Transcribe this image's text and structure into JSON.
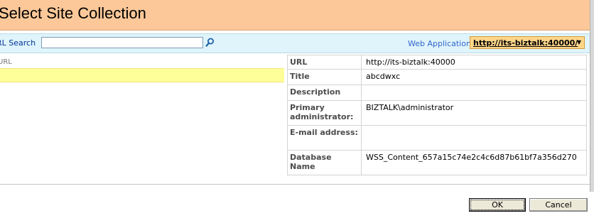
{
  "dialog": {
    "title": "Select Site Collection"
  },
  "search": {
    "label": "RL Search",
    "value": "",
    "button_icon": "search-icon"
  },
  "web_application": {
    "label": "Web Application:",
    "selected": "http://its-biztalk:40000/"
  },
  "site_list": {
    "column_header": "URL",
    "rows": [
      {
        "url": "/"
      }
    ]
  },
  "details": {
    "rows": [
      {
        "key": "URL",
        "value": "http://its-biztalk:40000"
      },
      {
        "key": "Title",
        "value": "abcdwxc"
      },
      {
        "key": "Description",
        "value": ""
      },
      {
        "key": "Primary administrator:",
        "value": "BIZTALK\\administrator"
      },
      {
        "key": "E-mail address:",
        "value": ""
      },
      {
        "key": "Database Name",
        "value": "WSS_Content_657a15c74e2c4c6d87b61bf7a356d270"
      }
    ]
  },
  "buttons": {
    "ok": "OK",
    "cancel": "Cancel"
  },
  "colors": {
    "title_bg": "#fcc899",
    "search_bg": "#dff4fb",
    "selected_row_bg": "#ffff99",
    "webapp_bg": "#fed68a"
  }
}
